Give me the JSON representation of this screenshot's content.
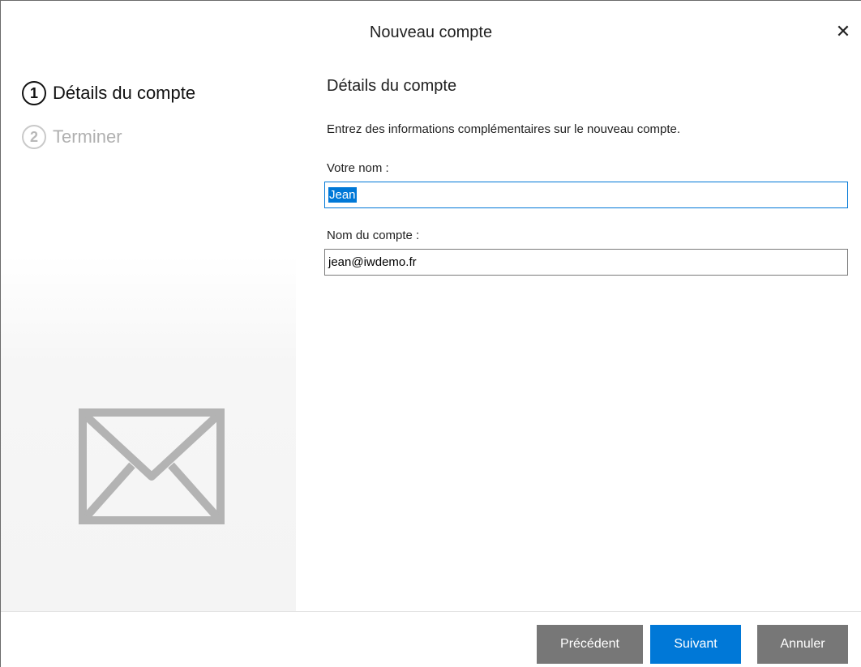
{
  "window": {
    "title": "Nouveau compte",
    "close_icon": "close-icon"
  },
  "steps": [
    {
      "number": "1",
      "label": "Détails du compte",
      "state": "active"
    },
    {
      "number": "2",
      "label": "Terminer",
      "state": "inactive"
    }
  ],
  "sidebar": {
    "illustration_icon": "envelope-icon"
  },
  "form": {
    "title": "Détails du compte",
    "description": "Entrez des informations complémentaires sur le nouveau compte.",
    "name_label": "Votre nom :",
    "name_value": "Jean",
    "account_label": "Nom du compte :",
    "account_value": "jean@iwdemo.fr"
  },
  "footer": {
    "previous_label": "Précédent",
    "next_label": "Suivant",
    "cancel_label": "Annuler"
  },
  "colors": {
    "accent": "#0078d7",
    "button_gray": "#777777"
  }
}
